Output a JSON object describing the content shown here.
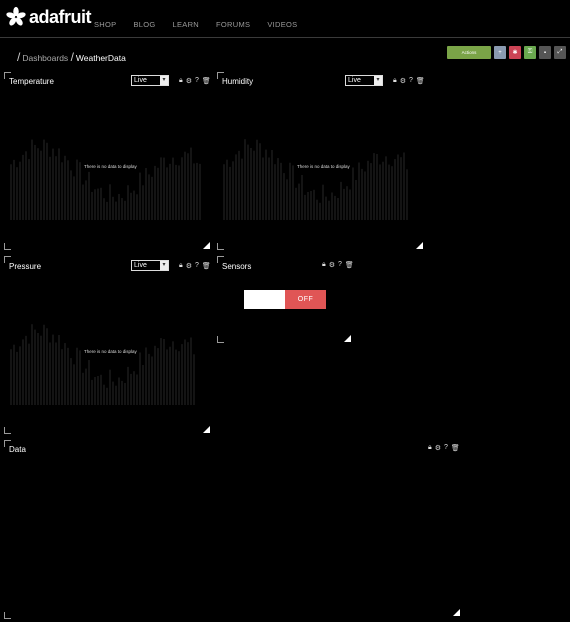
{
  "brand": {
    "name": "adafruit"
  },
  "nav": [
    "SHOP",
    "BLOG",
    "LEARN",
    "FORUMS",
    "VIDEOS"
  ],
  "breadcrumb": {
    "parent": "Dashboards",
    "current": "WeatherData"
  },
  "actions": {
    "primary": "Actions"
  },
  "blocks": {
    "temperature": {
      "title": "Temperature",
      "select_value": "Live",
      "nodata": "There is no data to display"
    },
    "humidity": {
      "title": "Humidity",
      "select_value": "Live",
      "nodata": "There is no data to display"
    },
    "pressure": {
      "title": "Pressure",
      "select_value": "Live",
      "nodata": "There is no data to display"
    },
    "sensors": {
      "title": "Sensors",
      "toggle_label": "OFF",
      "toggle_state": "off"
    },
    "data": {
      "title": "Data"
    }
  },
  "icons": [
    "lock-icon",
    "gear-icon",
    "help-icon",
    "trash-icon",
    "plus-icon",
    "star-icon",
    "key-icon",
    "lock-icon",
    "expand-icon"
  ],
  "colors": {
    "action_green": "#7aa447",
    "action_red": "#cc4455",
    "toggle_off": "#e05555"
  }
}
